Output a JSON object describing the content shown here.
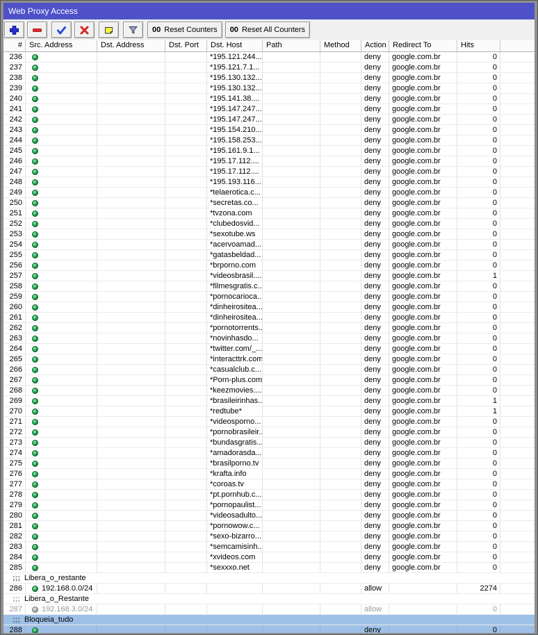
{
  "window": {
    "title": "Web Proxy Access"
  },
  "toolbar": {
    "reset_counters": {
      "prefix": "00",
      "label": "Reset Counters"
    },
    "reset_all_counters": {
      "prefix": "00",
      "label": "Reset All Counters"
    }
  },
  "colors": {
    "titlebar": "#4e51c8",
    "selection": "#9fc0e7",
    "disabled_text": "#9a9a9a",
    "enabled_dot": "#1fa24c"
  },
  "table": {
    "columns": [
      "#",
      "Src. Address",
      "Dst. Address",
      "Dst. Port",
      "Dst. Host",
      "Path",
      "Method",
      "Action",
      "Redirect To",
      "Hits",
      ""
    ],
    "comment_marker": ";;;",
    "rows": [
      {
        "number": "236",
        "dst_host": "*195.121.244...",
        "action": "deny",
        "redirect_to": "google.com.br",
        "hits": "0"
      },
      {
        "number": "237",
        "dst_host": "*195.121.7.1...",
        "action": "deny",
        "redirect_to": "google.com.br",
        "hits": "0"
      },
      {
        "number": "238",
        "dst_host": "*195.130.132...",
        "action": "deny",
        "redirect_to": "google.com.br",
        "hits": "0"
      },
      {
        "number": "239",
        "dst_host": "*195.130.132...",
        "action": "deny",
        "redirect_to": "google.com.br",
        "hits": "0"
      },
      {
        "number": "240",
        "dst_host": "*195.141.38....",
        "action": "deny",
        "redirect_to": "google.com.br",
        "hits": "0"
      },
      {
        "number": "241",
        "dst_host": "*195.147.247...",
        "action": "deny",
        "redirect_to": "google.com.br",
        "hits": "0"
      },
      {
        "number": "242",
        "dst_host": "*195.147.247...",
        "action": "deny",
        "redirect_to": "google.com.br",
        "hits": "0"
      },
      {
        "number": "243",
        "dst_host": "*195.154.210...",
        "action": "deny",
        "redirect_to": "google.com.br",
        "hits": "0"
      },
      {
        "number": "244",
        "dst_host": "*195.158.253...",
        "action": "deny",
        "redirect_to": "google.com.br",
        "hits": "0"
      },
      {
        "number": "245",
        "dst_host": "*195.161.9.1...",
        "action": "deny",
        "redirect_to": "google.com.br",
        "hits": "0"
      },
      {
        "number": "246",
        "dst_host": "*195.17.112....",
        "action": "deny",
        "redirect_to": "google.com.br",
        "hits": "0"
      },
      {
        "number": "247",
        "dst_host": "*195.17.112....",
        "action": "deny",
        "redirect_to": "google.com.br",
        "hits": "0"
      },
      {
        "number": "248",
        "dst_host": "*195.193.116...",
        "action": "deny",
        "redirect_to": "google.com.br",
        "hits": "0"
      },
      {
        "number": "249",
        "dst_host": "*telaerotica.c...",
        "action": "deny",
        "redirect_to": "google.com.br",
        "hits": "0"
      },
      {
        "number": "250",
        "dst_host": "*secretas.co...",
        "action": "deny",
        "redirect_to": "google.com.br",
        "hits": "0"
      },
      {
        "number": "251",
        "dst_host": "*tvzona.com",
        "action": "deny",
        "redirect_to": "google.com.br",
        "hits": "0"
      },
      {
        "number": "252",
        "dst_host": "*clubedosvid...",
        "action": "deny",
        "redirect_to": "google.com.br",
        "hits": "0"
      },
      {
        "number": "253",
        "dst_host": "*sexotube.ws",
        "action": "deny",
        "redirect_to": "google.com.br",
        "hits": "0"
      },
      {
        "number": "254",
        "dst_host": "*acervoamad...",
        "action": "deny",
        "redirect_to": "google.com.br",
        "hits": "0"
      },
      {
        "number": "255",
        "dst_host": "*gatasbeldad...",
        "action": "deny",
        "redirect_to": "google.com.br",
        "hits": "0"
      },
      {
        "number": "256",
        "dst_host": "*brporno.com",
        "action": "deny",
        "redirect_to": "google.com.br",
        "hits": "0"
      },
      {
        "number": "257",
        "dst_host": "*videosbrasil....",
        "action": "deny",
        "redirect_to": "google.com.br",
        "hits": "1"
      },
      {
        "number": "258",
        "dst_host": "*filmesgratis.c...",
        "action": "deny",
        "redirect_to": "google.com.br",
        "hits": "0"
      },
      {
        "number": "259",
        "dst_host": "*pornocarioca...",
        "action": "deny",
        "redirect_to": "google.com.br",
        "hits": "0"
      },
      {
        "number": "260",
        "dst_host": "*dinheirositea...",
        "action": "deny",
        "redirect_to": "google.com.br",
        "hits": "0"
      },
      {
        "number": "261",
        "dst_host": "*dinheirositea...",
        "action": "deny",
        "redirect_to": "google.com.br",
        "hits": "0"
      },
      {
        "number": "262",
        "dst_host": "*pornotorrents...",
        "action": "deny",
        "redirect_to": "google.com.br",
        "hits": "0"
      },
      {
        "number": "263",
        "dst_host": "*novinhasdo...",
        "action": "deny",
        "redirect_to": "google.com.br",
        "hits": "0"
      },
      {
        "number": "264",
        "dst_host": "*twitter.com/_...",
        "action": "deny",
        "redirect_to": "google.com.br",
        "hits": "0"
      },
      {
        "number": "265",
        "dst_host": "*interacttrk.com",
        "action": "deny",
        "redirect_to": "google.com.br",
        "hits": "0"
      },
      {
        "number": "266",
        "dst_host": "*casualclub.c...",
        "action": "deny",
        "redirect_to": "google.com.br",
        "hits": "0"
      },
      {
        "number": "267",
        "dst_host": "*Porn-plus.com",
        "action": "deny",
        "redirect_to": "google.com.br",
        "hits": "0"
      },
      {
        "number": "268",
        "dst_host": "*keezmovies....",
        "action": "deny",
        "redirect_to": "google.com.br",
        "hits": "0"
      },
      {
        "number": "269",
        "dst_host": "*brasileirinhas...",
        "action": "deny",
        "redirect_to": "google.com.br",
        "hits": "1"
      },
      {
        "number": "270",
        "dst_host": "*redtube*",
        "action": "deny",
        "redirect_to": "google.com.br",
        "hits": "1"
      },
      {
        "number": "271",
        "dst_host": "*videosporno...",
        "action": "deny",
        "redirect_to": "google.com.br",
        "hits": "0"
      },
      {
        "number": "272",
        "dst_host": "*pornobrasileir...",
        "action": "deny",
        "redirect_to": "google.com.br",
        "hits": "0"
      },
      {
        "number": "273",
        "dst_host": "*bundasgratis...",
        "action": "deny",
        "redirect_to": "google.com.br",
        "hits": "0"
      },
      {
        "number": "274",
        "dst_host": "*amadorasda...",
        "action": "deny",
        "redirect_to": "google.com.br",
        "hits": "0"
      },
      {
        "number": "275",
        "dst_host": "*brasilporno.tv",
        "action": "deny",
        "redirect_to": "google.com.br",
        "hits": "0"
      },
      {
        "number": "276",
        "dst_host": "*krafta.info",
        "action": "deny",
        "redirect_to": "google.com.br",
        "hits": "0"
      },
      {
        "number": "277",
        "dst_host": "*coroas.tv",
        "action": "deny",
        "redirect_to": "google.com.br",
        "hits": "0"
      },
      {
        "number": "278",
        "dst_host": "*pt.pornhub.c...",
        "action": "deny",
        "redirect_to": "google.com.br",
        "hits": "0"
      },
      {
        "number": "279",
        "dst_host": "*pornopaulist...",
        "action": "deny",
        "redirect_to": "google.com.br",
        "hits": "0"
      },
      {
        "number": "280",
        "dst_host": "*videosadulto...",
        "action": "deny",
        "redirect_to": "google.com.br",
        "hits": "0"
      },
      {
        "number": "281",
        "dst_host": "*pornowow.c...",
        "action": "deny",
        "redirect_to": "google.com.br",
        "hits": "0"
      },
      {
        "number": "282",
        "dst_host": "*sexo-bizarro....",
        "action": "deny",
        "redirect_to": "google.com.br",
        "hits": "0"
      },
      {
        "number": "283",
        "dst_host": "*semcamisinh...",
        "action": "deny",
        "redirect_to": "google.com.br",
        "hits": "0"
      },
      {
        "number": "284",
        "dst_host": "*xvideos.com",
        "action": "deny",
        "redirect_to": "google.com.br",
        "hits": "0"
      },
      {
        "number": "285",
        "dst_host": "*sexxxo.net",
        "action": "deny",
        "redirect_to": "google.com.br",
        "hits": "0"
      },
      {
        "comment": "Libera_o_restante"
      },
      {
        "number": "286",
        "src_address": "192.168.0.0/24",
        "action": "allow",
        "hits": "2274"
      },
      {
        "comment": "Libera_o_Restante",
        "disabled": true
      },
      {
        "number": "287",
        "src_address": "192.168.3.0/24",
        "action": "allow",
        "hits": "0",
        "disabled": true
      },
      {
        "comment": "Bloqueia_tudo",
        "selected": true
      },
      {
        "number": "288",
        "action": "deny",
        "hits": "0",
        "selected": true
      }
    ]
  }
}
